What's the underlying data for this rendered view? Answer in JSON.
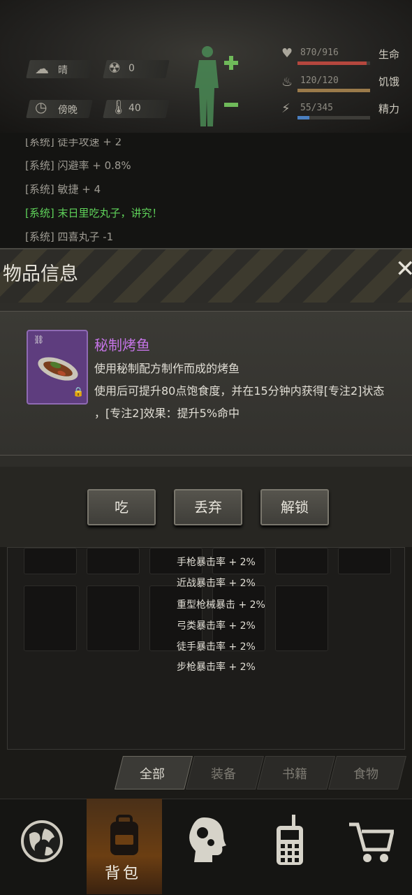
{
  "status": {
    "weather": "晴",
    "radiation": "0",
    "time_of_day": "傍晚",
    "temperature": "40"
  },
  "vitals": {
    "health": {
      "value": "870/916",
      "label": "生命",
      "fraction": 0.95,
      "color": "#b5473e"
    },
    "hunger": {
      "value": "120/120",
      "label": "饥饿",
      "fraction": 1.0,
      "color": "#9a7a4a"
    },
    "energy": {
      "value": "55/345",
      "label": "精力",
      "fraction": 0.16,
      "color": "#4a7fc0"
    }
  },
  "log": [
    {
      "text": "[系统] 徒手攻速 + 2",
      "color": "#9e9b93"
    },
    {
      "text": "[系统] 闪避率 + 0.8%",
      "color": "#9e9b93"
    },
    {
      "text": "[系统] 敏捷 + 4",
      "color": "#9e9b93"
    },
    {
      "text": "[系统] 末日里吃丸子，讲究！",
      "color": "#5fd35a"
    },
    {
      "text": "[系统] 四喜丸子 -1",
      "color": "#9e9b93"
    }
  ],
  "dialog": {
    "title": "物品信息",
    "close": "✕",
    "item": {
      "name": "秘制烤鱼",
      "desc1": "使用秘制配方制作而成的烤鱼",
      "desc2": "使用后可提升80点饱食度，并在15分钟内获得[专注2]状态",
      "desc3": "，[专注2]效果：提升5%命中"
    },
    "actions": [
      "吃",
      "丢弃",
      "解锁"
    ]
  },
  "bonuses": [
    "手枪暴击率 + 2%",
    "近战暴击率 + 2%",
    "重型枪械暴击 + 2%",
    "弓类暴击率 + 2%",
    "徒手暴击率 + 2%",
    "步枪暴击率 + 2%"
  ],
  "tabs": [
    "全部",
    "装备",
    "书籍",
    "食物"
  ],
  "nav": {
    "bag_label": "背包"
  }
}
